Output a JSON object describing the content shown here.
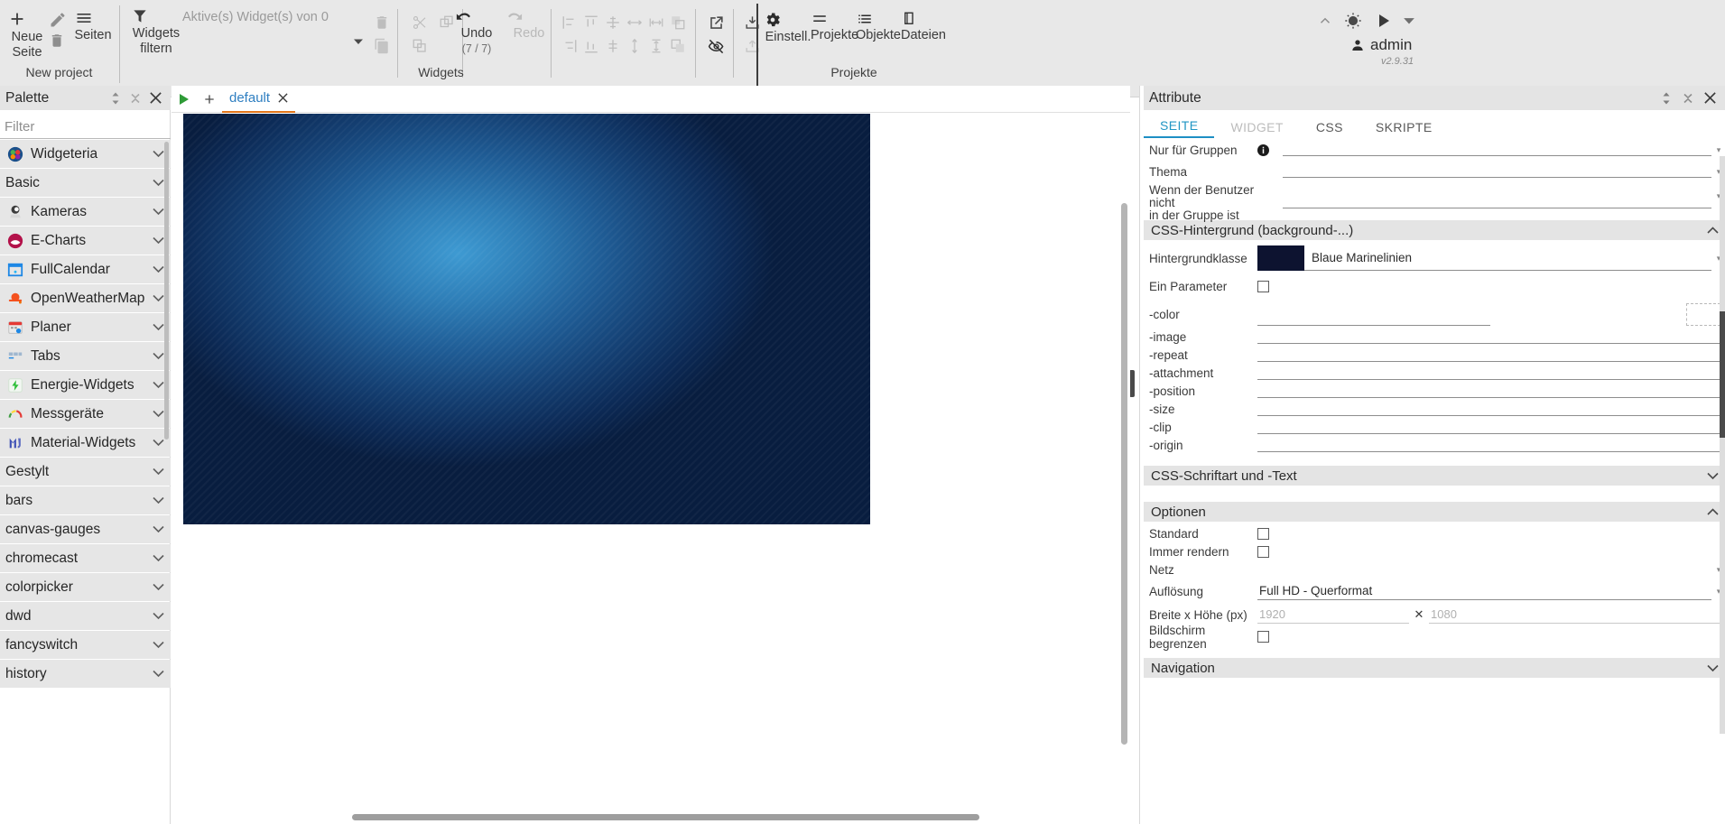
{
  "toolbar": {
    "project": {
      "new_page": "Neue\nSeite",
      "new_page_l1": "Neue",
      "new_page_l2": "Seite",
      "pages": "Seiten",
      "group_label": "New project"
    },
    "widgets": {
      "filter_l1": "Widgets",
      "filter_l2": "filtern",
      "active_widgets": "Aktive(s) Widget(s) von 0",
      "undo": "Undo",
      "undo_count": "(7 / 7)",
      "redo": "Redo",
      "group_label": "Widgets"
    },
    "projects": {
      "settings": "Einstell.",
      "projects": "Projekte",
      "objects": "Objekte",
      "files": "Dateien",
      "group_label": "Projekte"
    },
    "user": {
      "name": "admin",
      "version": "v2.9.31"
    }
  },
  "palette": {
    "title": "Palette",
    "filter_placeholder": "Filter",
    "items": [
      {
        "label": "Widgeteria",
        "icon": "widgeteria-icon",
        "collapsible": true
      },
      {
        "label": "Basic",
        "icon": "",
        "collapsible": true
      },
      {
        "label": "Kameras",
        "icon": "camera-icon",
        "collapsible": true
      },
      {
        "label": "E-Charts",
        "icon": "echarts-icon",
        "collapsible": true
      },
      {
        "label": "FullCalendar",
        "icon": "calendar-icon",
        "collapsible": true
      },
      {
        "label": "OpenWeatherMap",
        "icon": "weather-icon",
        "collapsible": true
      },
      {
        "label": "Planer",
        "icon": "planner-icon",
        "collapsible": true
      },
      {
        "label": "Tabs",
        "icon": "tabs-icon",
        "collapsible": true
      },
      {
        "label": "Energie-Widgets",
        "icon": "energy-icon",
        "collapsible": true
      },
      {
        "label": "Messgeräte",
        "icon": "gauge-icon",
        "collapsible": true
      },
      {
        "label": "Material-Widgets",
        "icon": "material-icon",
        "collapsible": true
      },
      {
        "label": "Gestylt",
        "icon": "",
        "collapsible": true
      },
      {
        "label": "bars",
        "icon": "",
        "collapsible": true
      },
      {
        "label": "canvas-gauges",
        "icon": "",
        "collapsible": true
      },
      {
        "label": "chromecast",
        "icon": "",
        "collapsible": true
      },
      {
        "label": "colorpicker",
        "icon": "",
        "collapsible": true
      },
      {
        "label": "dwd",
        "icon": "",
        "collapsible": true
      },
      {
        "label": "fancyswitch",
        "icon": "",
        "collapsible": true
      },
      {
        "label": "history",
        "icon": "",
        "collapsible": true
      }
    ]
  },
  "center": {
    "tab_label": "default"
  },
  "attributes": {
    "title": "Attribute",
    "tabs": [
      {
        "label": "SEITE",
        "state": "active"
      },
      {
        "label": "WIDGET",
        "state": "disabled"
      },
      {
        "label": "CSS",
        "state": "normal"
      },
      {
        "label": "SKRIPTE",
        "state": "normal"
      }
    ],
    "general_rows": [
      {
        "label": "Nur für Gruppen",
        "info": true,
        "value": ""
      },
      {
        "label": "Thema",
        "info": false,
        "value": ""
      }
    ],
    "group_not_row": {
      "line1": "Wenn der Benutzer nicht",
      "line2": "in der Gruppe ist",
      "value": ""
    },
    "bg_section": {
      "title": "CSS-Hintergrund (background-...)",
      "expanded": true,
      "class_label": "Hintergrundklasse",
      "class_value": "Blaue Marinelinien",
      "class_swatch": "#0d1330",
      "one_param_label": "Ein Parameter",
      "one_param_checked": false,
      "props": [
        {
          "label": "-color",
          "value": "",
          "has_color": true
        },
        {
          "label": "-image",
          "value": ""
        },
        {
          "label": "-repeat",
          "value": ""
        },
        {
          "label": "-attachment",
          "value": ""
        },
        {
          "label": "-position",
          "value": ""
        },
        {
          "label": "-size",
          "value": ""
        },
        {
          "label": "-clip",
          "value": ""
        },
        {
          "label": "-origin",
          "value": ""
        }
      ]
    },
    "font_section": {
      "title": "CSS-Schriftart und -Text",
      "expanded": false
    },
    "options_section": {
      "title": "Optionen",
      "expanded": true,
      "standard_label": "Standard",
      "standard_checked": false,
      "always_render_label": "Immer rendern",
      "always_render_checked": false,
      "grid_label": "Netz",
      "grid_value": "",
      "resolution_label": "Auflösung",
      "resolution_value": "Full HD - Querformat",
      "size_label": "Breite x Höhe (px)",
      "width_value": "1920",
      "height_value": "1080",
      "limit_label": "Bildschirm begrenzen",
      "limit_checked": false
    },
    "nav_section": {
      "title": "Navigation",
      "expanded": false
    }
  },
  "colors": {
    "toolbar_bg": "#e8e8e8",
    "accent_blue": "#2196c4",
    "tab_underline": "#e2761b",
    "view_bg": "#0d1330"
  }
}
